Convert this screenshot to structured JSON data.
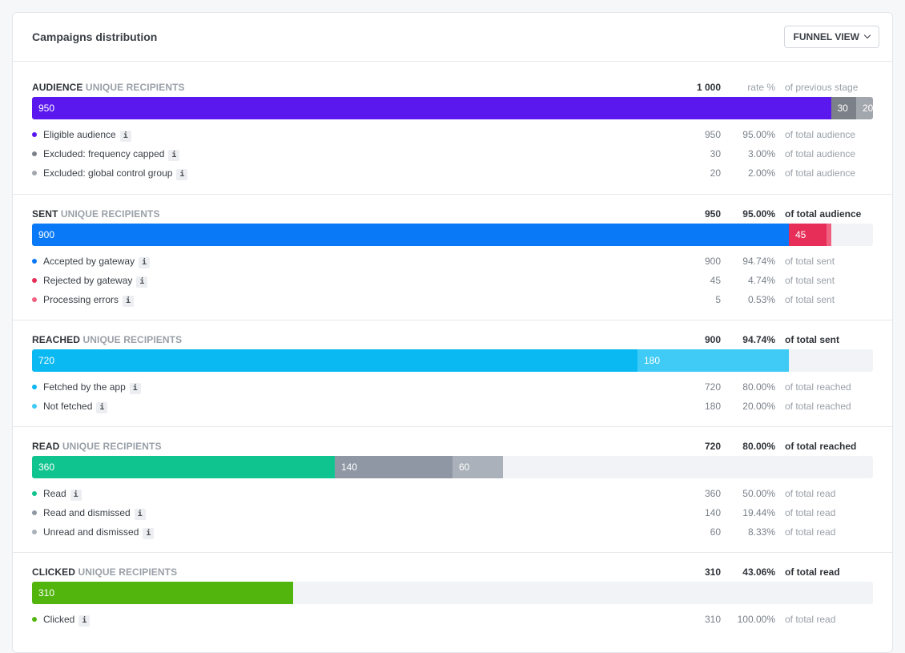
{
  "header": {
    "title": "Campaigns distribution",
    "view_button": "FUNNEL VIEW"
  },
  "colors": {
    "audience": [
      "#5a18ee",
      "#7c8088",
      "#a2a6ad"
    ],
    "sent": [
      "#0a79f7",
      "#e62e59",
      "#f0607f"
    ],
    "reached": [
      "#0ab8f2",
      "#3fcbf6"
    ],
    "read": [
      "#10c48f",
      "#8e97a3",
      "#aab1ba"
    ],
    "clicked": [
      "#52b50e"
    ]
  },
  "sections": {
    "audience": {
      "title": "AUDIENCE",
      "subtitle": "UNIQUE RECIPIENTS",
      "count": "1 000",
      "rate": "rate %",
      "of": "of previous stage",
      "bar": [
        {
          "label": "950",
          "fraction": 0.95
        },
        {
          "label": "30",
          "fraction": 0.03
        },
        {
          "label": "20",
          "fraction": 0.02
        }
      ],
      "rows": [
        {
          "label": "Eligible audience",
          "count": "950",
          "rate": "95.00%",
          "of": "of total audience"
        },
        {
          "label": "Excluded: frequency capped",
          "count": "30",
          "rate": "3.00%",
          "of": "of total audience"
        },
        {
          "label": "Excluded: global control group",
          "count": "20",
          "rate": "2.00%",
          "of": "of total audience"
        }
      ]
    },
    "sent": {
      "title": "SENT",
      "subtitle": "UNIQUE RECIPIENTS",
      "count": "950",
      "rate": "95.00%",
      "of": "of total audience",
      "bar": [
        {
          "label": "900",
          "fraction": 0.9
        },
        {
          "label": "45",
          "fraction": 0.045
        },
        {
          "label": "",
          "fraction": 0.005
        }
      ],
      "rows": [
        {
          "label": "Accepted by gateway",
          "count": "900",
          "rate": "94.74%",
          "of": "of total sent"
        },
        {
          "label": "Rejected by gateway",
          "count": "45",
          "rate": "4.74%",
          "of": "of total sent"
        },
        {
          "label": "Processing errors",
          "count": "5",
          "rate": "0.53%",
          "of": "of total sent"
        }
      ]
    },
    "reached": {
      "title": "REACHED",
      "subtitle": "UNIQUE RECIPIENTS",
      "count": "900",
      "rate": "94.74%",
      "of": "of total sent",
      "bar": [
        {
          "label": "720",
          "fraction": 0.72
        },
        {
          "label": "180",
          "fraction": 0.18
        }
      ],
      "rows": [
        {
          "label": "Fetched by the app",
          "count": "720",
          "rate": "80.00%",
          "of": "of total reached"
        },
        {
          "label": "Not fetched",
          "count": "180",
          "rate": "20.00%",
          "of": "of total reached"
        }
      ]
    },
    "read": {
      "title": "READ",
      "subtitle": "UNIQUE RECIPIENTS",
      "count": "720",
      "rate": "80.00%",
      "of": "of total reached",
      "bar": [
        {
          "label": "360",
          "fraction": 0.36
        },
        {
          "label": "140",
          "fraction": 0.14
        },
        {
          "label": "60",
          "fraction": 0.06
        }
      ],
      "rows": [
        {
          "label": "Read",
          "count": "360",
          "rate": "50.00%",
          "of": "of total read"
        },
        {
          "label": "Read and dismissed",
          "count": "140",
          "rate": "19.44%",
          "of": "of total read"
        },
        {
          "label": "Unread and dismissed",
          "count": "60",
          "rate": "8.33%",
          "of": "of total read"
        }
      ]
    },
    "clicked": {
      "title": "CLICKED",
      "subtitle": "UNIQUE RECIPIENTS",
      "count": "310",
      "rate": "43.06%",
      "of": "of total read",
      "bar": [
        {
          "label": "310",
          "fraction": 0.31
        }
      ],
      "rows": [
        {
          "label": "Clicked",
          "count": "310",
          "rate": "100.00%",
          "of": "of total read"
        }
      ]
    }
  }
}
